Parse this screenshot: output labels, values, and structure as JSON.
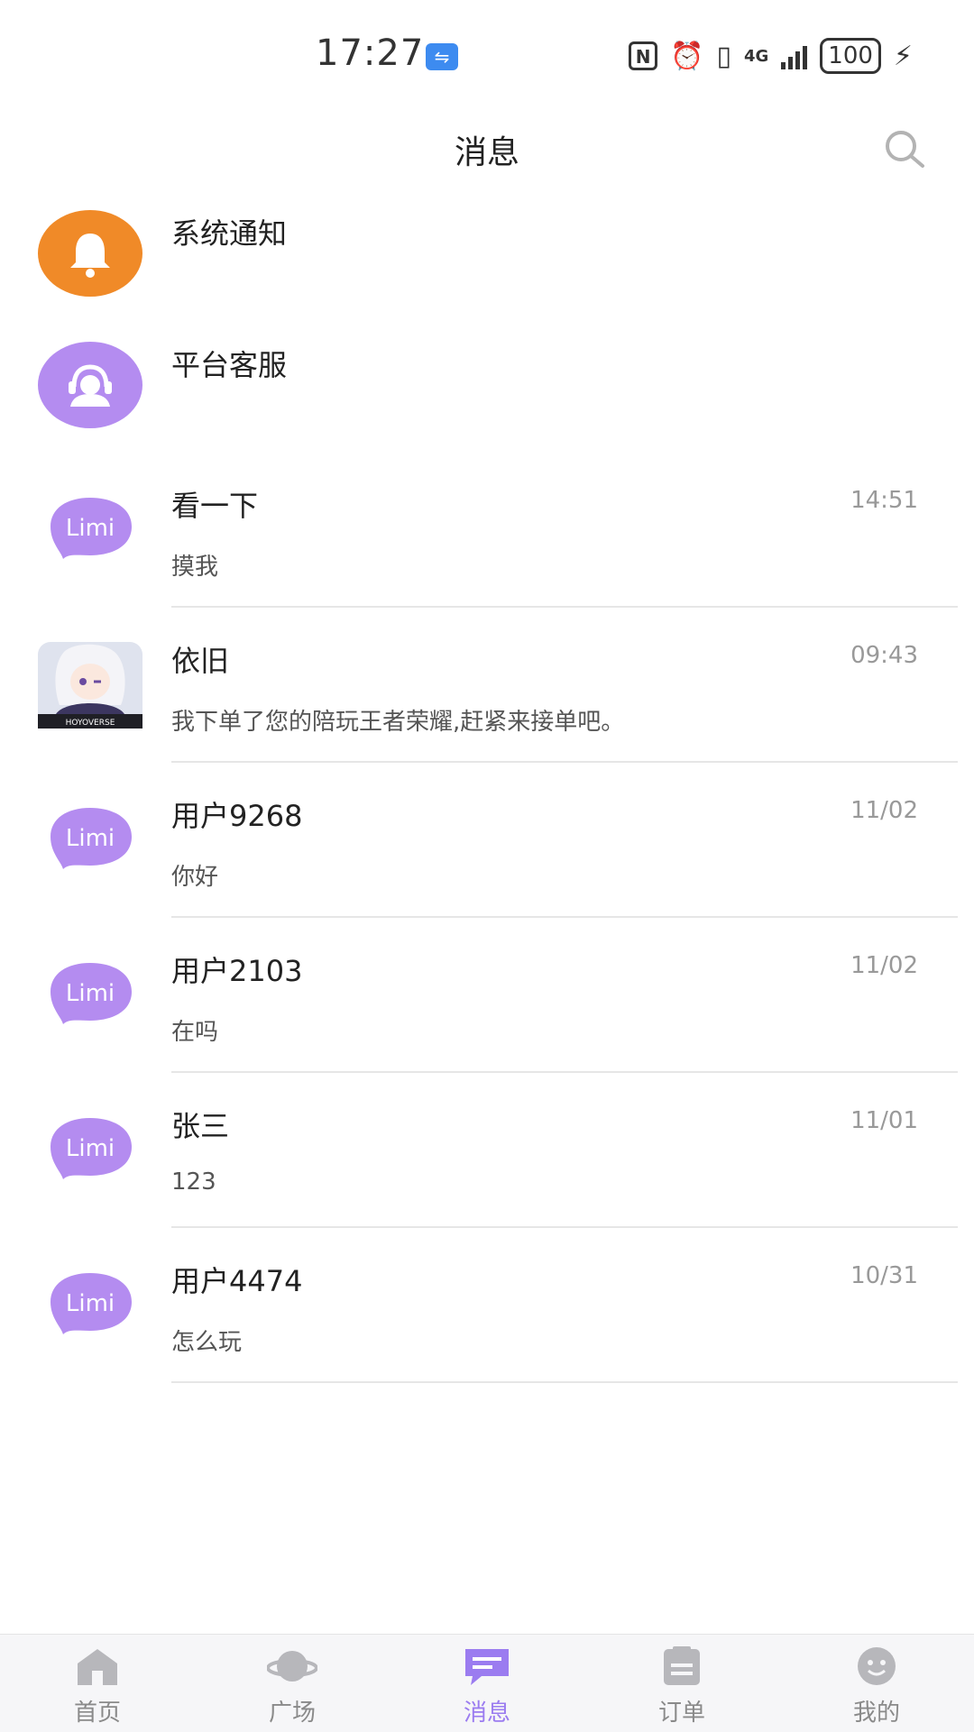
{
  "status": {
    "time": "17:27",
    "battery": "100",
    "network": "4G"
  },
  "header": {
    "title": "消息"
  },
  "system_items": [
    {
      "name": "系统通知",
      "icon": "bell-icon",
      "color": "#f08a28"
    },
    {
      "name": "平台客服",
      "icon": "customer-service-icon",
      "color": "#b48cf0"
    }
  ],
  "conversations": [
    {
      "name": "看一下",
      "time": "14:51",
      "preview": "摸我",
      "avatar": "limi"
    },
    {
      "name": "依旧",
      "time": "09:43",
      "preview": "我下单了您的陪玩王者荣耀,赶紧来接单吧。",
      "avatar": "anime",
      "avatar_caption": "HOYOVERSE"
    },
    {
      "name": "用户9268",
      "time": "11/02",
      "preview": "你好",
      "avatar": "limi"
    },
    {
      "name": "用户2103",
      "time": "11/02",
      "preview": "在吗",
      "avatar": "limi"
    },
    {
      "name": "张三",
      "time": "11/01",
      "preview": "123",
      "avatar": "limi"
    },
    {
      "name": "用户4474",
      "time": "10/31",
      "preview": "怎么玩",
      "avatar": "limi"
    }
  ],
  "avatar_logo_text": "Limi",
  "tabs": [
    {
      "label": "首页",
      "icon": "home-icon"
    },
    {
      "label": "广场",
      "icon": "planet-icon"
    },
    {
      "label": "消息",
      "icon": "message-icon",
      "active": true
    },
    {
      "label": "订单",
      "icon": "order-icon"
    },
    {
      "label": "我的",
      "icon": "profile-icon"
    }
  ],
  "colors": {
    "accent": "#9b7cf0",
    "limi_purple": "#b48cf0",
    "orange": "#f08a28",
    "muted": "#999999"
  }
}
